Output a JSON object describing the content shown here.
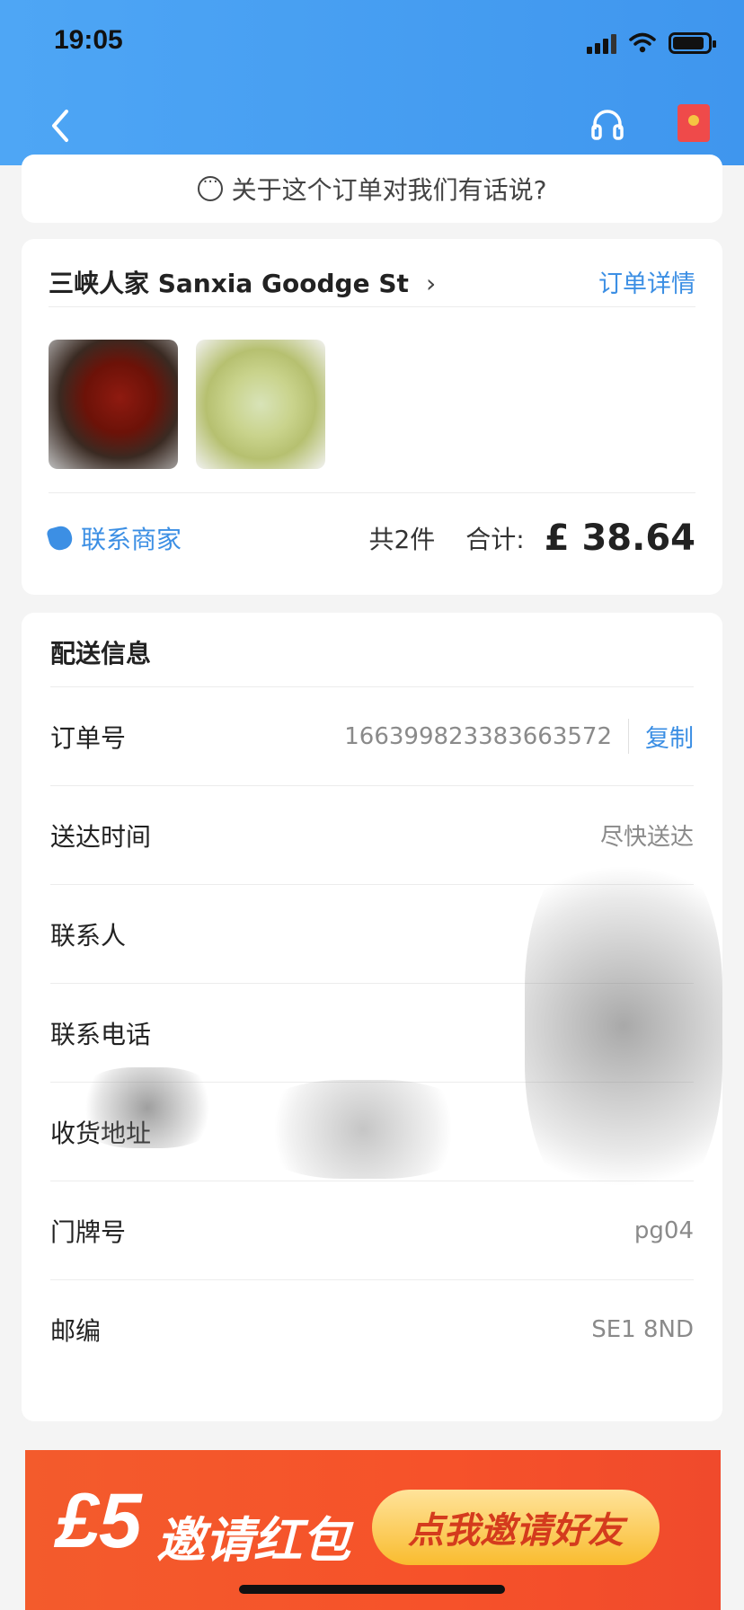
{
  "status_bar": {
    "time": "19:05"
  },
  "feedback": {
    "text": "关于这个订单对我们有话说?"
  },
  "shop": {
    "name": "三峡人家 Sanxia Goodge St",
    "detail_link": "订单详情",
    "contact_label": "联系商家",
    "count_text": "共2件",
    "total_label": "合计:",
    "total_price": "£ 38.64"
  },
  "delivery": {
    "title": "配送信息",
    "rows": [
      {
        "label": "订单号",
        "value": "1663998233836635​72"
      },
      {
        "label": "送达时间",
        "value": "尽快送达"
      },
      {
        "label": "联系人",
        "value": ""
      },
      {
        "label": "联系电话",
        "value": ""
      },
      {
        "label": "收货地址",
        "value": ""
      },
      {
        "label": "门牌号",
        "value": "pg04"
      },
      {
        "label": "邮编",
        "value": "SE1 8ND"
      }
    ],
    "copy_label": "复制"
  },
  "banner": {
    "amount": "£5",
    "text": "邀请红包",
    "button": "点我邀请好友"
  },
  "colors": {
    "header": "#4ea6f5",
    "link": "#3c8fe4",
    "banner": "#f35b2c"
  }
}
